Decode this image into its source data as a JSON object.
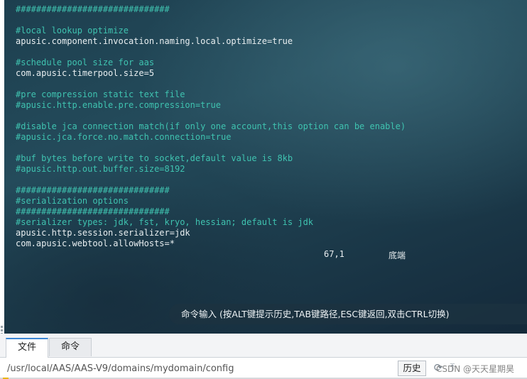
{
  "terminal": {
    "lines": [
      {
        "text": "##############################",
        "kind": "comment"
      },
      {
        "text": "",
        "kind": "code"
      },
      {
        "text": "#local lookup optimize",
        "kind": "comment"
      },
      {
        "text": "apusic.component.invocation.naming.local.optimize=true",
        "kind": "code"
      },
      {
        "text": "",
        "kind": "code"
      },
      {
        "text": "#schedule pool size for aas",
        "kind": "comment"
      },
      {
        "text": "com.apusic.timerpool.size=5",
        "kind": "code"
      },
      {
        "text": "",
        "kind": "code"
      },
      {
        "text": "#pre compression static text file",
        "kind": "comment"
      },
      {
        "text": "#apusic.http.enable.pre.compression=true",
        "kind": "comment"
      },
      {
        "text": "",
        "kind": "code"
      },
      {
        "text": "#disable jca connection match(if only one account,this option can be enable)",
        "kind": "comment"
      },
      {
        "text": "#apusic.jca.force.no.match.connection=true",
        "kind": "comment"
      },
      {
        "text": "",
        "kind": "code"
      },
      {
        "text": "#buf bytes before write to socket,default value is 8kb",
        "kind": "comment"
      },
      {
        "text": "#apusic.http.out.buffer.size=8192",
        "kind": "comment"
      },
      {
        "text": "",
        "kind": "code"
      },
      {
        "text": "##############################",
        "kind": "comment"
      },
      {
        "text": "#serialization options",
        "kind": "comment"
      },
      {
        "text": "##############################",
        "kind": "comment"
      },
      {
        "text": "#serializer types: jdk, fst, kryo, hessian; default is jdk",
        "kind": "comment"
      },
      {
        "text": "apusic.http.session.serializer=jdk",
        "kind": "code"
      },
      {
        "text": "com.apusic.webtool.allowHosts=*",
        "kind": "code"
      }
    ],
    "cursor_position": "67,1",
    "scroll_position": "底端",
    "command_hint": "命令输入 (按ALT键提示历史,TAB键路径,ESC键返回,双击CTRL切换)"
  },
  "tabs": [
    {
      "label": "文件",
      "active": true
    },
    {
      "label": "命令",
      "active": false
    }
  ],
  "pathbar": {
    "path": "/usr/local/AAS/AAS-V9/domains/mydomain/config",
    "history_label": "历史",
    "watermark": "CSDN @天天星期昊",
    "icons": [
      "refresh-icon",
      "upload-icon"
    ]
  },
  "colors": {
    "comment": "#3fc3b0",
    "code": "#e8eef0",
    "tab_accent": "#3a86d4"
  }
}
